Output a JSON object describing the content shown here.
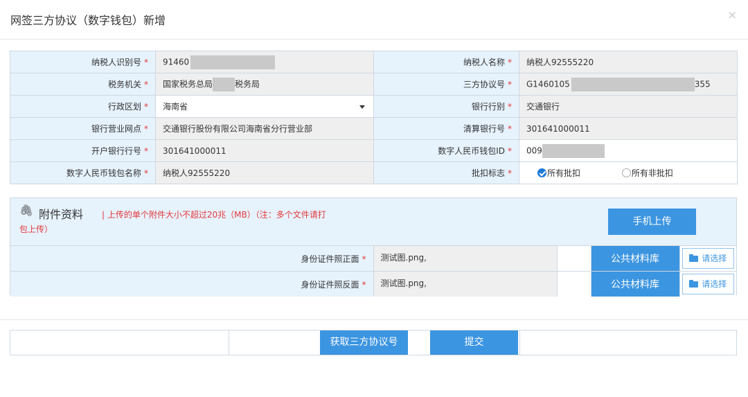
{
  "dialog": {
    "title": "网签三方协议（数字钱包）新增",
    "close_label": "×"
  },
  "required_mark": "*",
  "form": {
    "rows": [
      [
        {
          "label": "纳税人识别号",
          "value": "91460"
        },
        {
          "label": "纳税人名称",
          "value": "纳税人92555220"
        }
      ],
      [
        {
          "label": "税务机关",
          "value_prefix": "国家税务总局",
          "value_suffix": "税务局"
        },
        {
          "label": "三方协议号",
          "value_prefix": "G1460105",
          "value_suffix": "355"
        }
      ],
      [
        {
          "label": "行政区划",
          "value": "海南省"
        },
        {
          "label": "银行行别",
          "value": "交通银行"
        }
      ],
      [
        {
          "label": "银行营业网点",
          "value": "交通银行股份有限公司海南省分行营业部"
        },
        {
          "label": "清算银行号",
          "value": "301641000011"
        }
      ],
      [
        {
          "label": "开户银行行号",
          "value": "301641000011"
        },
        {
          "label": "数字人民币钱包ID",
          "value": "009"
        }
      ],
      [
        {
          "label": "数字人民币钱包名称",
          "value": "纳税人92555220"
        },
        {
          "label": "批扣标志",
          "options": [
            "所有批扣",
            "所有非批扣"
          ],
          "selected": "所有批扣"
        }
      ]
    ]
  },
  "attachments": {
    "title": "附件资料",
    "note_line1": "| 上传的单个附件大小不超过20兆（MB）（注：多个文件请打",
    "note_line2": "包上传）",
    "mobile_upload": "手机上传",
    "rows": [
      {
        "label": "身份证件照正面",
        "file": "测试图.png,",
        "library": "公共材料库",
        "select": "请选择"
      },
      {
        "label": "身份证件照反面",
        "file": "测试图.png,",
        "library": "公共材料库",
        "select": "请选择"
      }
    ]
  },
  "footer": {
    "get_agreement_no": "获取三方协议号",
    "submit": "提交"
  },
  "colors": {
    "accent": "#3c95e0",
    "label_bg": "#e6f2fc",
    "readonly_bg": "#efefef",
    "required": "#e4393c"
  }
}
